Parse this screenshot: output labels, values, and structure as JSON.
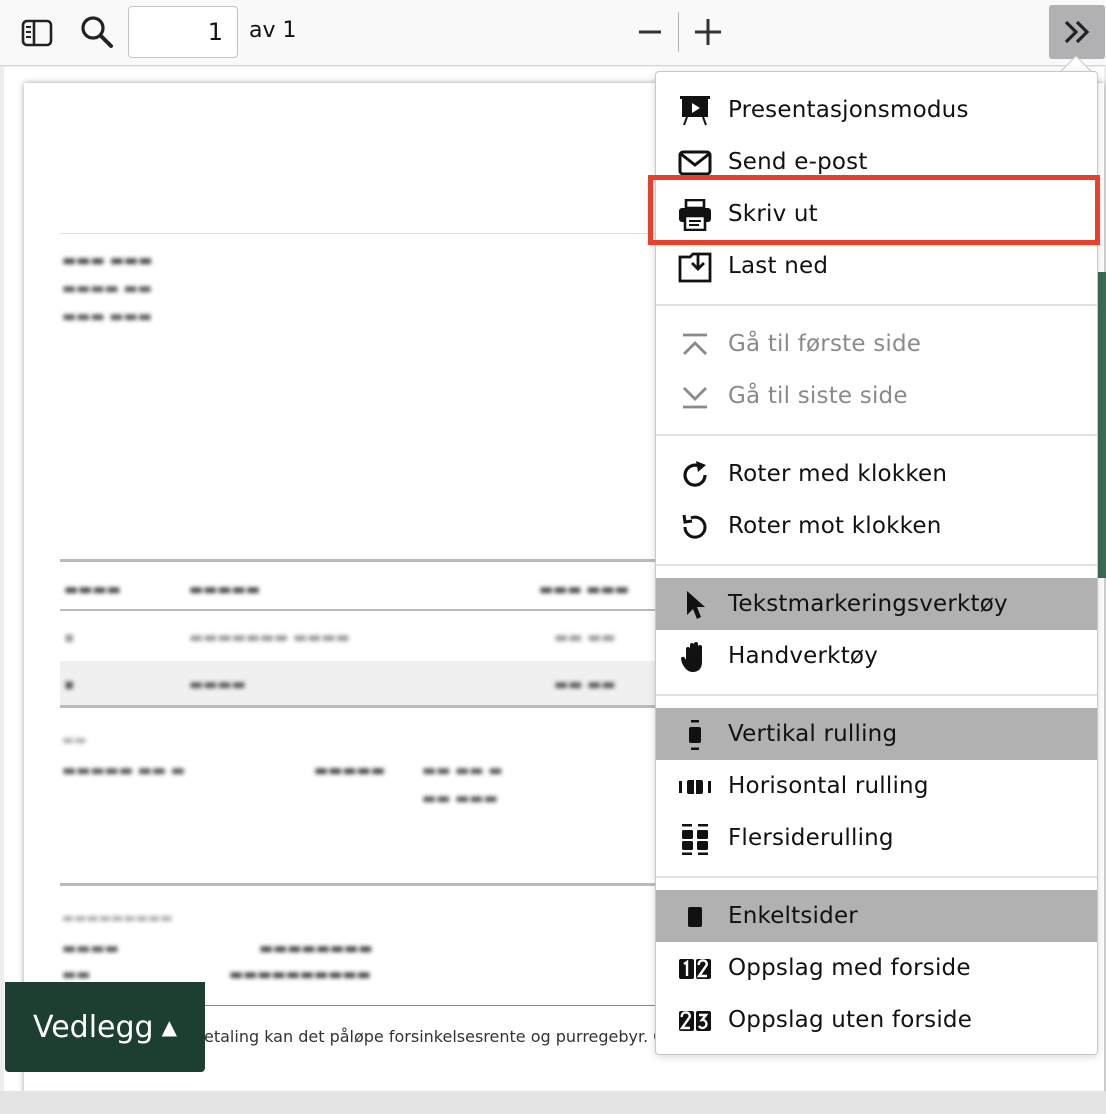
{
  "toolbar": {
    "sidebar_icon": "sidebar-toggle-icon",
    "search_icon": "search-icon",
    "page_number": "1",
    "page_of": "av 1",
    "zoom_out_icon": "minus-icon",
    "zoom_in_icon": "plus-icon",
    "tools_icon": "double-chevron-right-icon"
  },
  "document": {
    "footer_text": "etaling kan det påløpe forsinkelsesrente og purregebyr. Gebyr"
  },
  "attachment_button": {
    "label": "Vedlegg",
    "arrow": "▲"
  },
  "menu": {
    "items": [
      {
        "label": "Presentasjonsmodus",
        "icon": "presentation-icon"
      },
      {
        "label": "Send e-post",
        "icon": "envelope-icon"
      },
      {
        "label": "Skriv ut",
        "icon": "printer-icon"
      },
      {
        "label": "Last ned",
        "icon": "download-icon"
      },
      {
        "label": "Gå til første side",
        "icon": "first-page-icon"
      },
      {
        "label": "Gå til siste side",
        "icon": "last-page-icon"
      },
      {
        "label": "Roter med klokken",
        "icon": "rotate-clockwise-icon"
      },
      {
        "label": "Roter mot klokken",
        "icon": "rotate-counterclockwise-icon"
      },
      {
        "label": "Tekstmarkeringsverktøy",
        "icon": "cursor-arrow-icon"
      },
      {
        "label": "Handverktøy",
        "icon": "hand-icon"
      },
      {
        "label": "Vertikal rulling",
        "icon": "vertical-scroll-icon"
      },
      {
        "label": "Horisontal rulling",
        "icon": "horizontal-scroll-icon"
      },
      {
        "label": "Flersiderulling",
        "icon": "wrapped-scroll-icon"
      },
      {
        "label": "Enkeltsider",
        "icon": "single-page-icon"
      },
      {
        "label": "Oppslag med forside",
        "icon": "odd-spreads-icon"
      },
      {
        "label": "Oppslag uten forside",
        "icon": "even-spreads-icon"
      }
    ]
  },
  "colors": {
    "highlight": "#e8402a",
    "accent_green": "#1c3f32",
    "selected_bg": "#b1b1b1"
  }
}
